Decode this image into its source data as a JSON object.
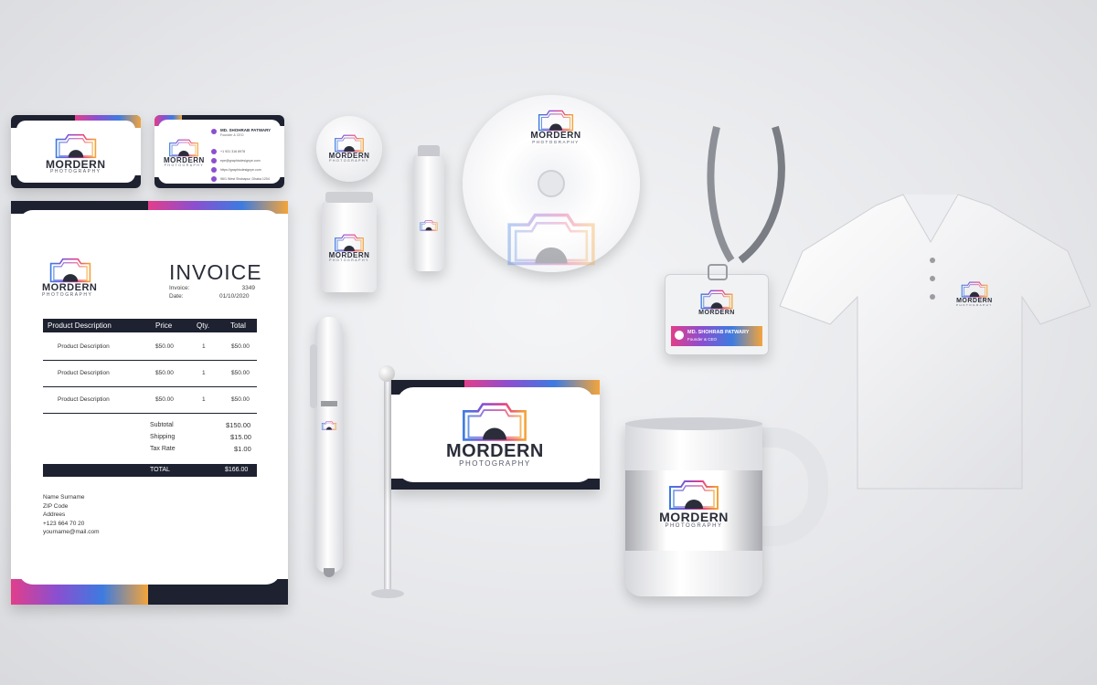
{
  "brand": {
    "name": "MORDERN",
    "tagline": "PHOTOGRAPHY"
  },
  "business_card": {
    "person_name": "MD. SHOHRAB PATWARY",
    "person_title": "Founder & CEO",
    "contacts": [
      "+1 931 316 8978",
      "epe@graphicdesignye.com",
      "https://graphicdesignye.com",
      "96/1 West Shobapur, Dhaka 1204"
    ]
  },
  "invoice": {
    "title": "INVOICE",
    "meta": [
      {
        "label": "Invoice:",
        "value": "3349"
      },
      {
        "label": "Date:",
        "value": "01/10/2020"
      }
    ],
    "columns": [
      "Product Description",
      "Price",
      "Qty.",
      "Total"
    ],
    "rows": [
      {
        "desc": "Product Description",
        "price": "$50.00",
        "qty": "1",
        "total": "$50.00"
      },
      {
        "desc": "Product Description",
        "price": "$50.00",
        "qty": "1",
        "total": "$50.00"
      },
      {
        "desc": "Product Description",
        "price": "$50.00",
        "qty": "1",
        "total": "$50.00"
      }
    ],
    "subtotal_label": "Subtotal",
    "subtotal": "$150.00",
    "shipping_label": "Shipping",
    "shipping": "$15.00",
    "tax_label": "Tax Rate",
    "tax": "$1.00",
    "total_label": "TOTAL",
    "total": "$166.00",
    "address": [
      "Name Surname",
      "ZIP Code",
      "Addrees",
      "+123 664 70 20",
      "yourname@mail.com"
    ]
  },
  "id_badge": {
    "name": "MD. SHOHRAB PATWARY",
    "title": "Founder & CEO"
  },
  "colors": {
    "navy": "#1d2130",
    "pink": "#e23e8a",
    "purple": "#8b4fd0",
    "blue": "#3d7be0",
    "orange": "#f4a43a"
  }
}
